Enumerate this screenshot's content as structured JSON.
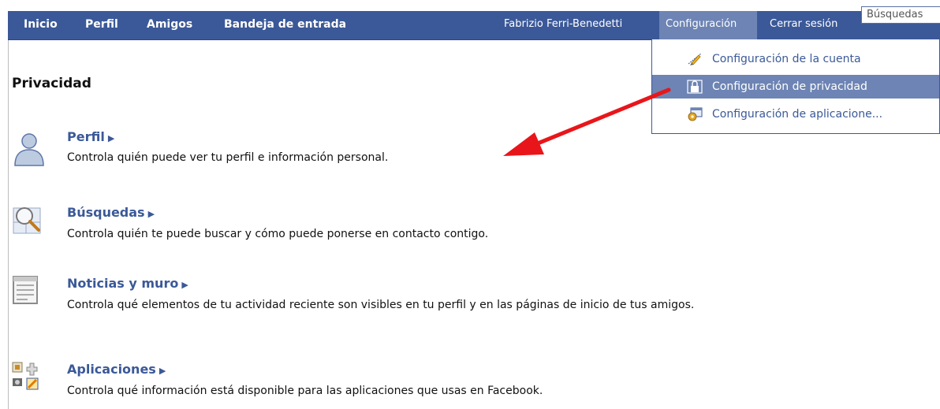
{
  "nav": {
    "home": "Inicio",
    "profile": "Perfil",
    "friends": "Amigos",
    "inbox": "Bandeja de entrada",
    "user": "Fabrizio Ferri-Benedetti",
    "settings": "Configuración",
    "logout": "Cerrar sesión",
    "search_placeholder": "Búsquedas"
  },
  "menu": {
    "items": [
      {
        "label": "Configuración de la cuenta",
        "icon": "pencil-icon"
      },
      {
        "label": "Configuración de privacidad",
        "icon": "lock-icon"
      },
      {
        "label": "Configuración de aplicacione...",
        "icon": "application-gear-icon"
      }
    ]
  },
  "page": {
    "title": "Privacidad",
    "sections": [
      {
        "title": "Perfil",
        "desc": "Controla quién puede ver tu perfil e información personal.",
        "icon": "person-icon"
      },
      {
        "title": "Búsquedas",
        "desc": "Controla quién te puede buscar y cómo puede ponerse en contacto contigo.",
        "icon": "magnifier-icon"
      },
      {
        "title": "Noticias y muro",
        "desc": "Controla qué elementos de tu actividad reciente son visibles en tu perfil y en las páginas de inicio de tus amigos.",
        "icon": "news-feed-icon"
      },
      {
        "title": "Aplicaciones",
        "desc": "Controla qué información está disponible para las aplicaciones que usas en Facebook.",
        "icon": "applications-icon"
      }
    ]
  },
  "colors": {
    "brand": "#3b5998",
    "highlight": "#6d84b4",
    "annotation_arrow": "#e8161a"
  }
}
